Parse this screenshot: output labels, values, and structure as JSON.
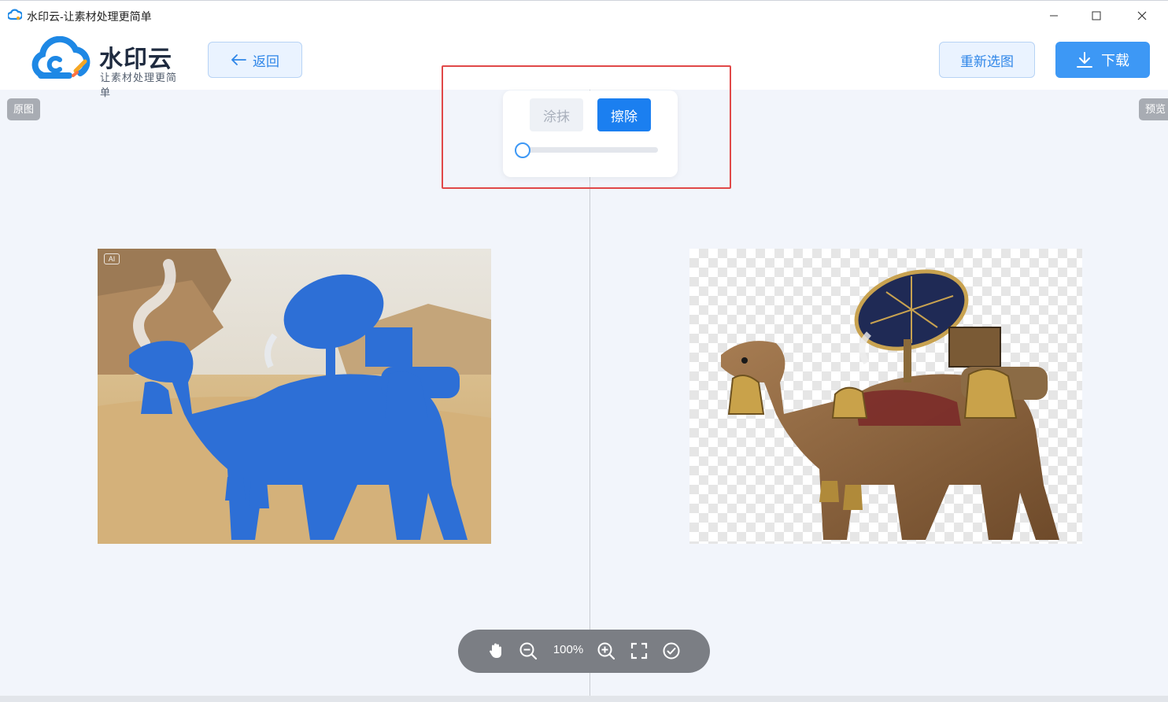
{
  "window": {
    "title": "水印云-让素材处理更简单"
  },
  "header": {
    "logo_title": "水印云",
    "logo_subtitle": "让素材处理更简单",
    "back_label": "返回",
    "reselect_label": "重新选图",
    "download_label": "下载"
  },
  "tags": {
    "original": "原图",
    "preview": "预览"
  },
  "tool_panel": {
    "smear_label": "涂抹",
    "erase_label": "擦除",
    "active_tool": "擦除",
    "brush_size_fraction": 0.0
  },
  "image": {
    "ai_badge": "AI"
  },
  "bottom_toolbar": {
    "zoom": "100%",
    "icons": [
      "hand-icon",
      "zoom-out-icon",
      "zoom-in-icon",
      "fullscreen-icon",
      "check-circle-icon"
    ]
  },
  "colors": {
    "accent": "#3d98f5",
    "mask_blue": "#2d6fd6",
    "highlight_red": "#e04848"
  }
}
